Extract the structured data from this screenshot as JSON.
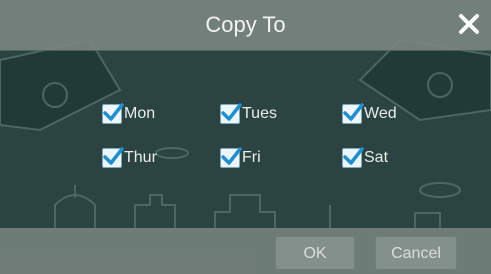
{
  "dialog": {
    "title": "Copy To",
    "close_icon": "close-icon"
  },
  "days": [
    {
      "label": "Mon",
      "checked": true
    },
    {
      "label": "Tues",
      "checked": true
    },
    {
      "label": "Wed",
      "checked": true
    },
    {
      "label": "Thur",
      "checked": true
    },
    {
      "label": "Fri",
      "checked": true
    },
    {
      "label": "Sat",
      "checked": true
    }
  ],
  "footer": {
    "ok_label": "OK",
    "cancel_label": "Cancel"
  },
  "colors": {
    "check_blue": "#1e8fd0",
    "title_text": "#f2f4f3"
  }
}
